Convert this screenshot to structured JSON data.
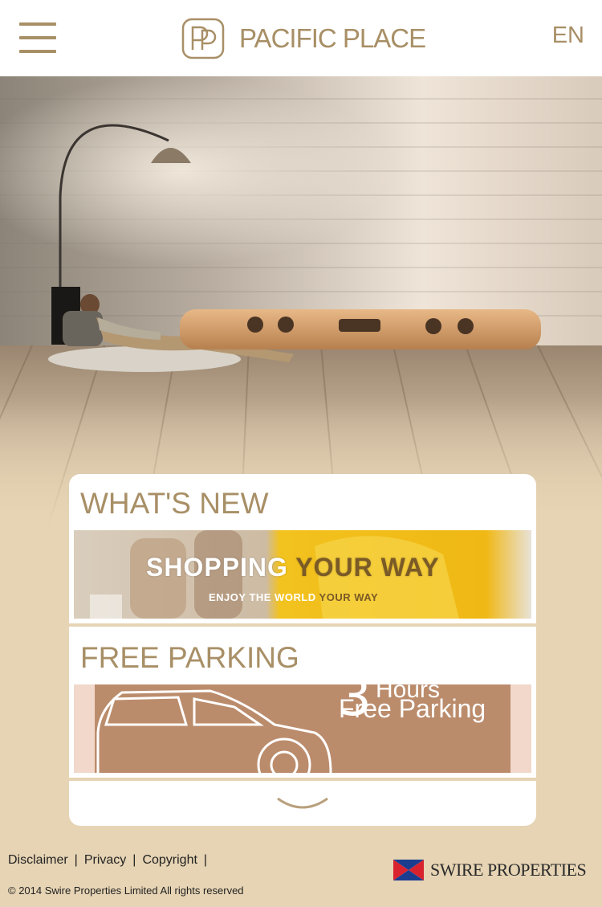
{
  "header": {
    "brand_name": "PACIFIC PLACE",
    "language": "EN"
  },
  "sections": [
    {
      "title": "WHAT'S NEW",
      "banner_main_a": "SHOPPING ",
      "banner_main_b": "YOUR WAY",
      "banner_sub_a": "ENJOY THE WORLD ",
      "banner_sub_b": "YOUR WAY"
    },
    {
      "title": "FREE PARKING",
      "banner_number": "3",
      "banner_hours": "Hours",
      "banner_text": "Free Parking"
    }
  ],
  "footer": {
    "links": [
      "Disclaimer",
      "Privacy",
      "Copyright"
    ],
    "copyright": "© 2014 Swire Properties Limited All rights reserved",
    "company": "SWIRE PROPERTIES"
  },
  "colors": {
    "brand_gold": "#a88f66",
    "background_beige": "#e6d4b4"
  },
  "icons": [
    "hamburger-menu-icon",
    "pacific-place-logo-icon",
    "chevron-down-icon",
    "swire-flag-icon"
  ]
}
